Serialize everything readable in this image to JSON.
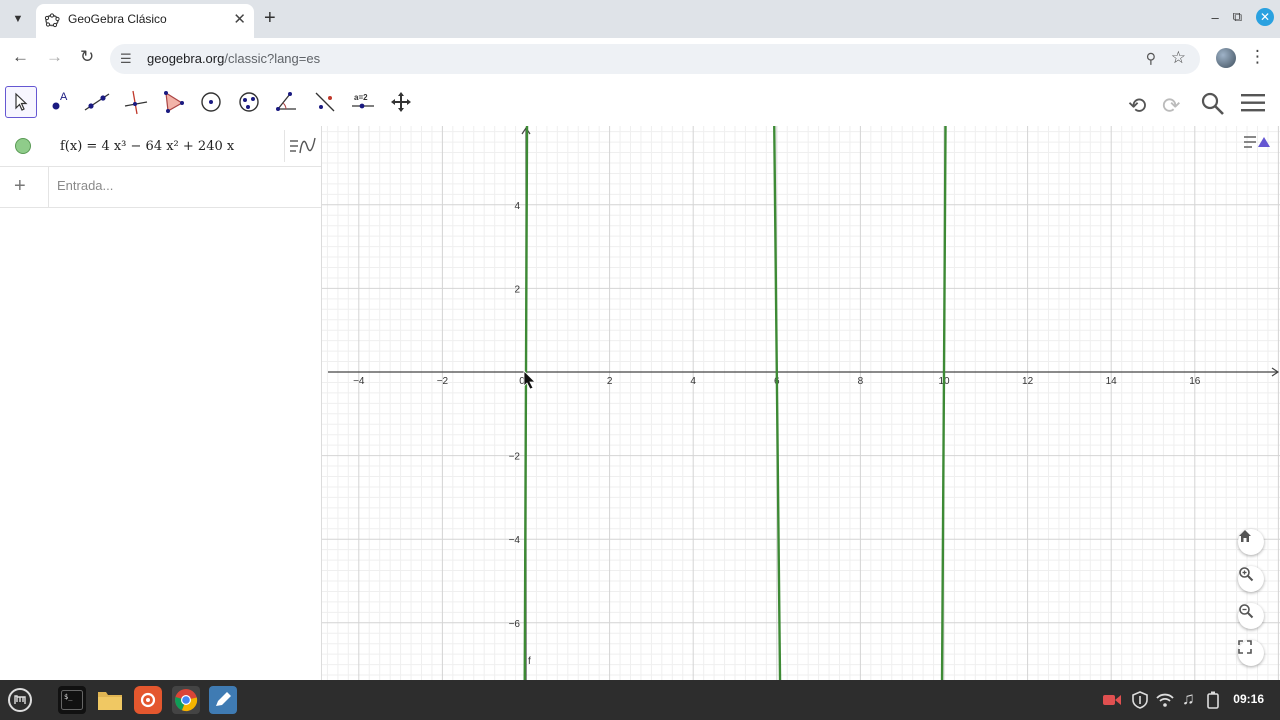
{
  "browser": {
    "tab_title": "GeoGebra Clásico",
    "url_host": "geogebra.org",
    "url_rest": "/classic?lang=es"
  },
  "algebra": {
    "expression": "f(x) = 4 x³ − 64 x² + 240 x",
    "input_placeholder": "Entrada..."
  },
  "graph": {
    "function_label": "f",
    "function_color": "#3d8a35",
    "x_ticks": [
      "-4",
      "-2",
      "0",
      "2",
      "4",
      "6",
      "8",
      "10",
      "12",
      "14",
      "16"
    ],
    "y_ticks": [
      "4",
      "2",
      "-2",
      "-4",
      "-6"
    ]
  },
  "taskbar": {
    "clock": "09:16"
  }
}
